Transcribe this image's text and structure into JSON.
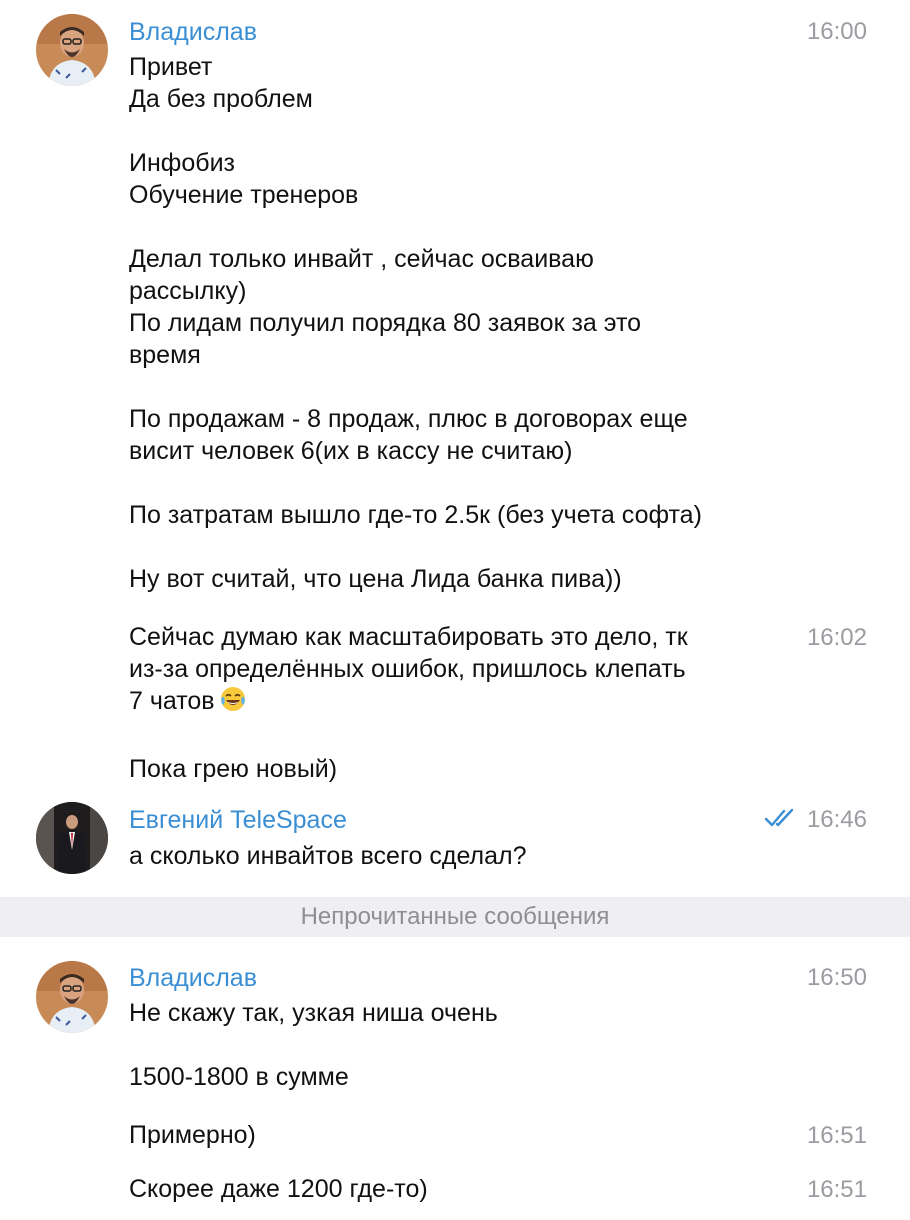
{
  "messages": [
    {
      "sender": "Владислав",
      "time": "16:00",
      "lines": [
        "Привет",
        "Да без проблем",
        "",
        "Инфобиз",
        "Обучение тренеров",
        "",
        "Делал только инвайт , сейчас осваиваю",
        "рассылку)",
        "По лидам получил порядка 80 заявок за это",
        "время",
        "",
        "По продажам - 8 продаж, плюс в договорах еще",
        "висит человек 6(их в кассу не считаю)",
        "",
        "По затратам вышло где-то 2.5к (без учета софта)",
        "",
        "Ну вот считай, что цена Лида банка пива))"
      ]
    },
    {
      "time": "16:02",
      "lines": [
        "Сейчас думаю как масштабировать это дело, тк",
        "из-за определённых ошибок, пришлось клепать",
        "7 чатов",
        "",
        "Пока грею новый)"
      ],
      "emoji": "😂"
    },
    {
      "sender": "Евгений TeleSpace",
      "time": "16:46",
      "lines": [
        "а сколько инвайтов всего сделал?"
      ]
    },
    {
      "sender": "Владислав",
      "time": "16:50",
      "lines": [
        "Не скажу так, узкая ниша очень",
        "",
        "1500-1800 в сумме"
      ]
    },
    {
      "time": "16:51",
      "lines": [
        "Примерно)"
      ]
    },
    {
      "time": "16:51",
      "lines": [
        "Скорее даже 1200 где-то)"
      ]
    }
  ],
  "divider": "Непрочитанные сообщения",
  "colors": {
    "sender": "#3a8ed3",
    "time": "#9b9ba1",
    "text": "#111111",
    "divider_bg": "#efeff2",
    "read_ticks": "#3a8ed3"
  },
  "icons": {
    "read_status": "double-check-icon"
  }
}
